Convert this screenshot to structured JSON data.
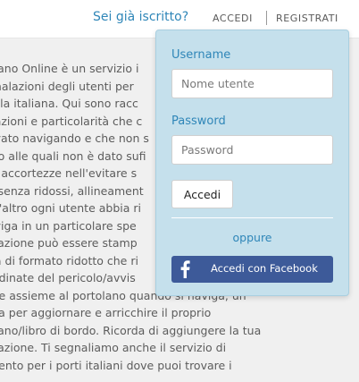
{
  "header": {
    "prompt": "Sei già iscritto?",
    "login_link": "ACCEDI",
    "register_link": "REGISTRATI"
  },
  "background_text": [
    "olano Online è un servizio i",
    "gnalazioni degli utenti per",
    "sola italiana. Qui sono racc",
    "eazioni e particolarità che c",
    "ovato navigando e che non s",
    "e o alle quali non è dato sufi",
    "di accortezze nell'evitare s",
    "e senza ridossi, allineament",
    "nt'altro ogni utente abbia ri",
    "aviga in un particolare spe",
    "alazione può essere stamp",
    "na di formato ridotto che ri",
    "ordinate del pericolo/avvis",
    "are assieme al portolano quando si naviga, un",
    "ma per aggiornare e arricchire il proprio",
    "olano/libro di bordo. Ricorda di aggiungere la tua",
    "alazione. Ti segnaliamo anche il servizio di",
    "mento per i porti italiani dove puoi trovare i"
  ],
  "login_popover": {
    "username_label": "Username",
    "username_placeholder": "Nome utente",
    "password_label": "Password",
    "password_placeholder": "Password",
    "submit_label": "Accedi",
    "or_text": "oppure",
    "facebook_label": "Accedi con Facebook",
    "facebook_icon": "facebook-f-icon"
  },
  "colors": {
    "accent_blue": "#2f86b8",
    "popover_bg": "#c5e0ec",
    "facebook_blue": "#3d5a99",
    "content_bg": "#f0f0f0"
  }
}
